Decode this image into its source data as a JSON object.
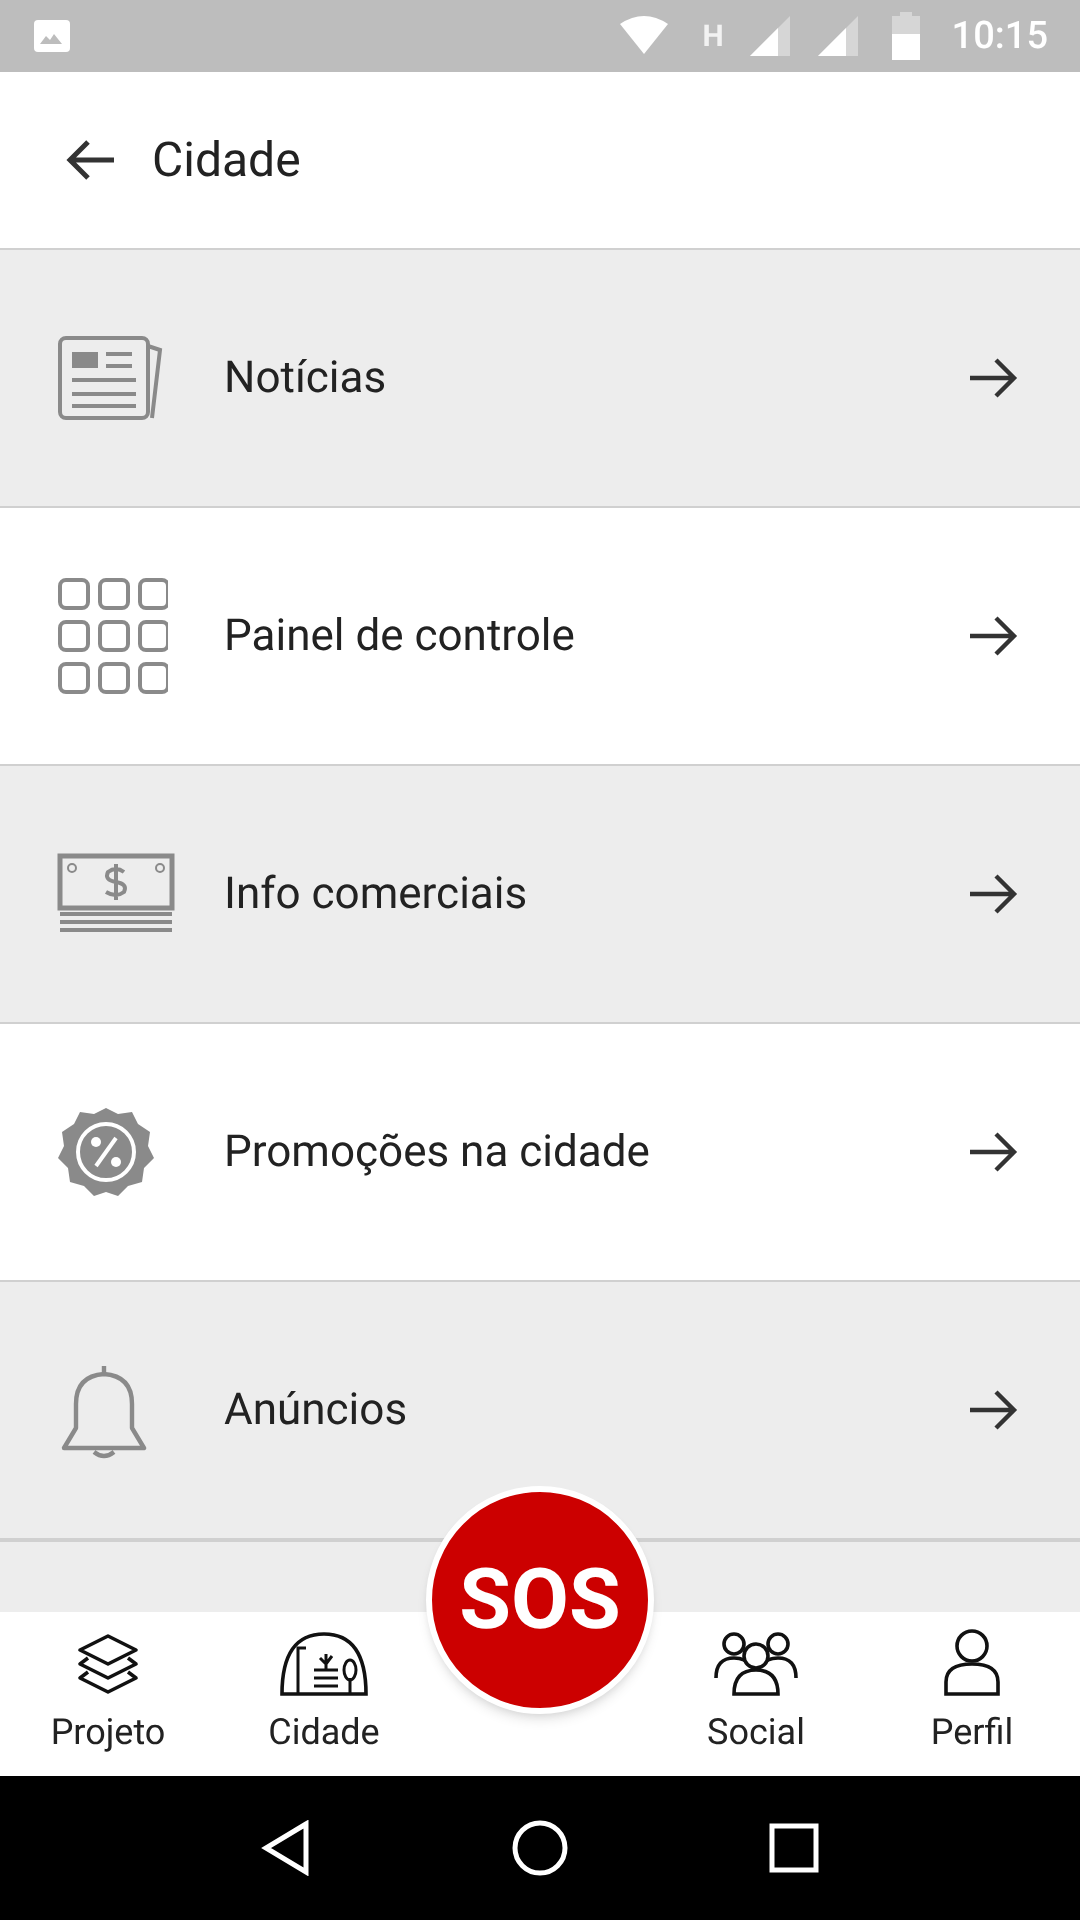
{
  "status_bar": {
    "network_type": "H",
    "time": "10:15"
  },
  "header": {
    "title": "Cidade"
  },
  "menu_items": [
    {
      "kind": "news",
      "label": "Notícias"
    },
    {
      "kind": "grid",
      "label": "Painel de controle"
    },
    {
      "kind": "money",
      "label": "Info comerciais"
    },
    {
      "kind": "discount",
      "label": "Promoções na cidade"
    },
    {
      "kind": "bell",
      "label": "Anúncios"
    }
  ],
  "bottom_nav": {
    "items": [
      {
        "kind": "layers",
        "label": "Projeto"
      },
      {
        "kind": "city",
        "label": "Cidade"
      },
      {
        "kind": "sos",
        "label": "SOS"
      },
      {
        "kind": "people",
        "label": "Social"
      },
      {
        "kind": "person",
        "label": "Perfil"
      }
    ]
  }
}
